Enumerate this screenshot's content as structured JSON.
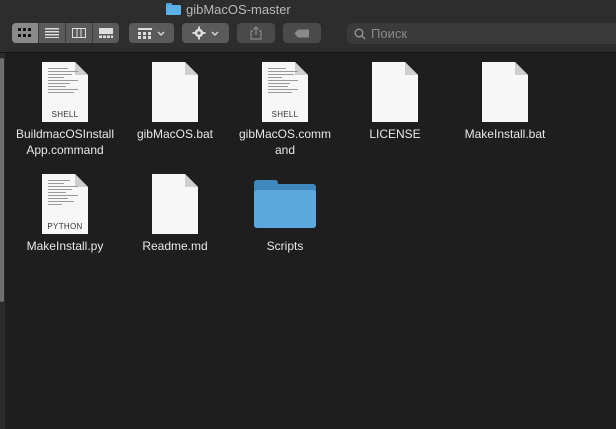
{
  "window": {
    "title": "gibMacOS-master",
    "search_placeholder": "Поиск"
  },
  "toolbar": {
    "view_buttons": [
      "icon-view",
      "list-view",
      "column-view",
      "gallery-view"
    ],
    "active_view": "icon-view"
  },
  "files": [
    {
      "name": "BuildmacOSInstallApp.command",
      "label_line1": "BuildmacOSInstall",
      "label_line2": "App.command",
      "icon": "shell-script-icon",
      "tag": "SHELL"
    },
    {
      "name": "gibMacOS.bat",
      "label_line1": "gibMacOS.bat",
      "label_line2": "",
      "icon": "blank-document-icon",
      "tag": ""
    },
    {
      "name": "gibMacOS.command",
      "label_line1": "gibMacOS.comm",
      "label_line2": "and",
      "icon": "shell-script-icon",
      "tag": "SHELL"
    },
    {
      "name": "LICENSE",
      "label_line1": "LICENSE",
      "label_line2": "",
      "icon": "blank-document-icon",
      "tag": ""
    },
    {
      "name": "MakeInstall.bat",
      "label_line1": "MakeInstall.bat",
      "label_line2": "",
      "icon": "blank-document-icon",
      "tag": ""
    },
    {
      "name": "MakeInstall.py",
      "label_line1": "MakeInstall.py",
      "label_line2": "",
      "icon": "python-script-icon",
      "tag": "PYTHON"
    },
    {
      "name": "Readme.md",
      "label_line1": "Readme.md",
      "label_line2": "",
      "icon": "blank-document-icon",
      "tag": ""
    },
    {
      "name": "Scripts",
      "label_line1": "Scripts",
      "label_line2": "",
      "icon": "folder-icon",
      "tag": ""
    }
  ],
  "colors": {
    "background": "#1e1e1e",
    "toolbar": "#2d2d2d",
    "folder_blue": "#5aa8de"
  }
}
